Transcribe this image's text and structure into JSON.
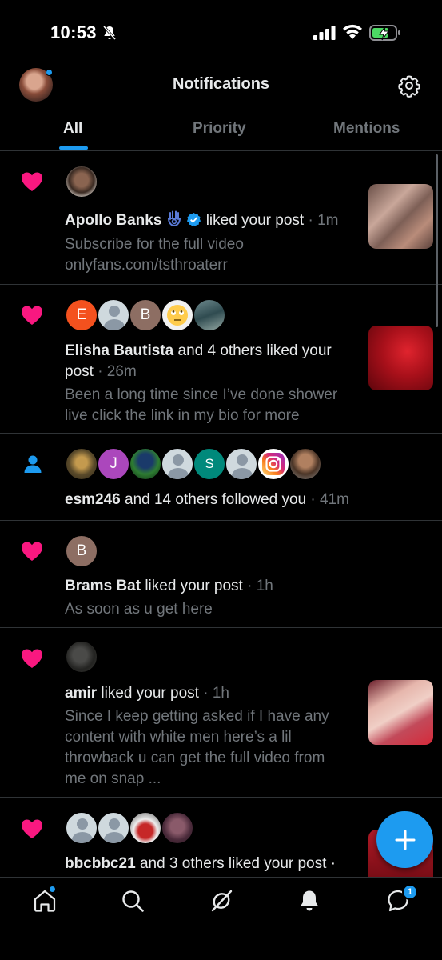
{
  "status": {
    "time": "10:53"
  },
  "header": {
    "title": "Notifications"
  },
  "tabs": [
    {
      "label": "All",
      "active": true
    },
    {
      "label": "Priority",
      "active": false
    },
    {
      "label": "Mentions",
      "active": false
    }
  ],
  "notifications": [
    {
      "type": "like",
      "name": "Apollo Banks",
      "action": "liked your post",
      "time": "· 1m",
      "preview_lines": [
        "Subscribe for the full video",
        "onlyfans.com/tsthroaterr"
      ]
    },
    {
      "type": "like",
      "name": "Elisha Bautista",
      "action": "and 4 others liked your",
      "action_line2": "post",
      "time": "· 26m",
      "avatar_letters": [
        "E",
        "B"
      ],
      "preview_lines": [
        "Been a long time since I’ve done shower",
        "live click the link in my bio for more"
      ]
    },
    {
      "type": "follow",
      "name": "esm246",
      "action": "and 14 others followed you",
      "time": "· 41m",
      "avatar_letters": [
        "J",
        "S"
      ]
    },
    {
      "type": "like",
      "name": "Brams Bat",
      "action": "liked your post",
      "time": "· 1h",
      "avatar_letters": [
        "B"
      ],
      "preview_lines": [
        "As soon as u get here"
      ]
    },
    {
      "type": "like",
      "name": "amir",
      "action": "liked your post",
      "time": "· 1h",
      "preview_lines": [
        "Since I keep getting asked if I have any",
        "content with white men here’s a lil",
        "throwback u can get the full video from",
        "me on snap ..."
      ]
    },
    {
      "type": "like",
      "name": "bbcbbc21",
      "action": "and 3 others liked your post ·"
    }
  ],
  "bottom_nav": {
    "messages_badge": "1"
  },
  "colors": {
    "accent": "#1d9bf0",
    "like": "#f91880",
    "background": "#000000",
    "muted": "#71767b"
  }
}
